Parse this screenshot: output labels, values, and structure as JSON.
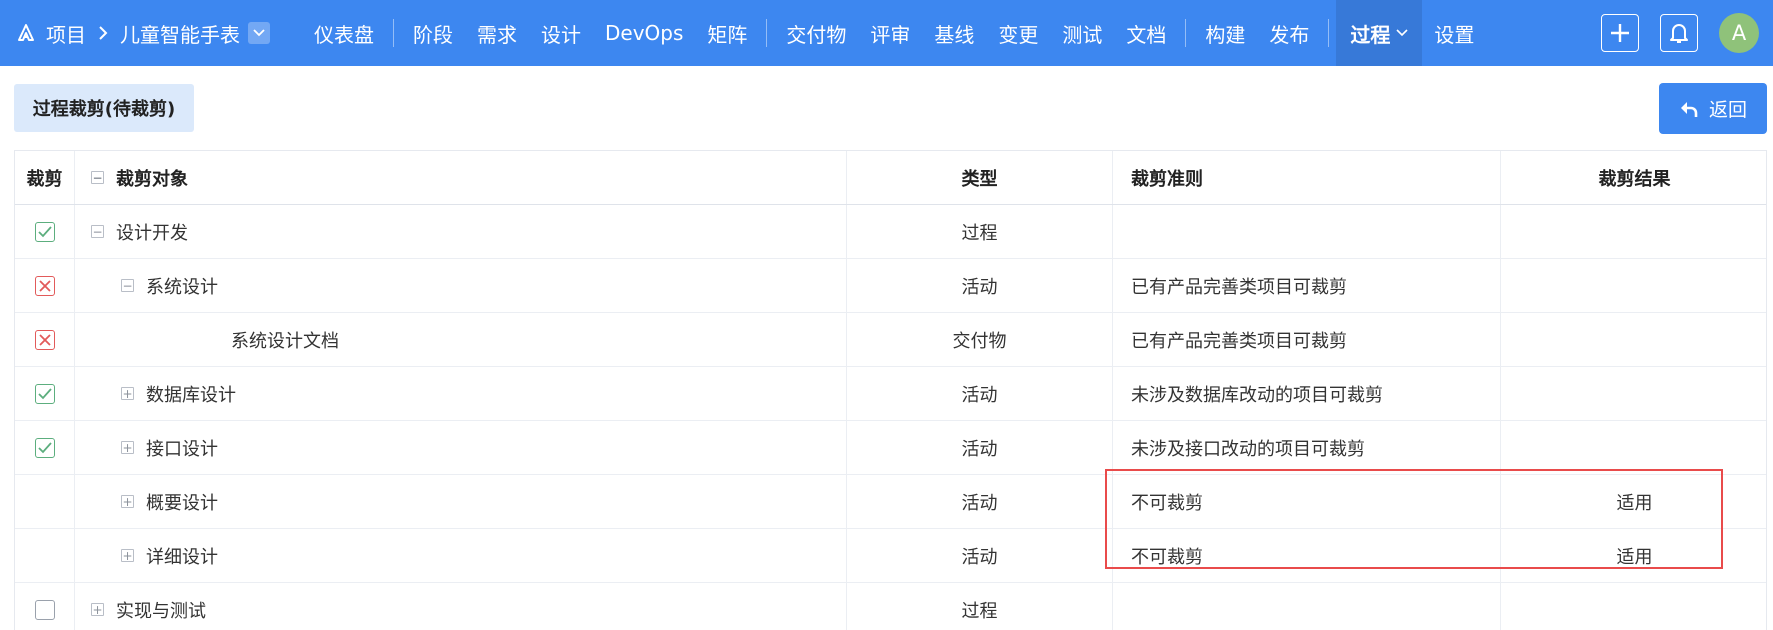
{
  "breadcrumb": {
    "root": "项目",
    "project": "儿童智能手表"
  },
  "nav": {
    "group1": [
      "仪表盘"
    ],
    "group2": [
      "阶段",
      "需求",
      "设计",
      "DevOps",
      "矩阵"
    ],
    "group3": [
      "交付物",
      "评审",
      "基线",
      "变更",
      "测试",
      "文档"
    ],
    "group4": [
      "构建",
      "发布"
    ],
    "active": "过程",
    "after": "设置"
  },
  "user": {
    "avatar_initial": "A"
  },
  "page": {
    "tag": "过程裁剪(待裁剪)",
    "back_label": "返回"
  },
  "table": {
    "headers": {
      "cut": "裁剪",
      "object": "裁剪对象",
      "type": "类型",
      "rule": "裁剪准则",
      "result": "裁剪结果"
    },
    "rows": [
      {
        "check": "checked",
        "toggle": "minus",
        "level": 0,
        "name": "设计开发",
        "type": "过程",
        "rule": "",
        "result": ""
      },
      {
        "check": "crossed",
        "toggle": "minus",
        "level": 1,
        "name": "系统设计",
        "type": "活动",
        "rule": "已有产品完善类项目可裁剪",
        "result": ""
      },
      {
        "check": "crossed",
        "toggle": "none",
        "level": 2,
        "name": "系统设计文档",
        "type": "交付物",
        "rule": "已有产品完善类项目可裁剪",
        "result": ""
      },
      {
        "check": "checked",
        "toggle": "plus",
        "level": 1,
        "name": "数据库设计",
        "type": "活动",
        "rule": "未涉及数据库改动的项目可裁剪",
        "result": ""
      },
      {
        "check": "checked",
        "toggle": "plus",
        "level": 1,
        "name": "接口设计",
        "type": "活动",
        "rule": "未涉及接口改动的项目可裁剪",
        "result": ""
      },
      {
        "check": "none",
        "toggle": "plus",
        "level": 1,
        "name": "概要设计",
        "type": "活动",
        "rule": "不可裁剪",
        "result": "适用"
      },
      {
        "check": "none",
        "toggle": "plus",
        "level": 1,
        "name": "详细设计",
        "type": "活动",
        "rule": "不可裁剪",
        "result": "适用"
      },
      {
        "check": "empty",
        "toggle": "plus",
        "level": 0,
        "name": "实现与测试",
        "type": "过程",
        "rule": "",
        "result": ""
      }
    ]
  },
  "colors": {
    "primary": "#3d87f0",
    "check_ok": "#5cae7e",
    "check_no": "#e25a5a",
    "highlight": "#e94b4b"
  }
}
